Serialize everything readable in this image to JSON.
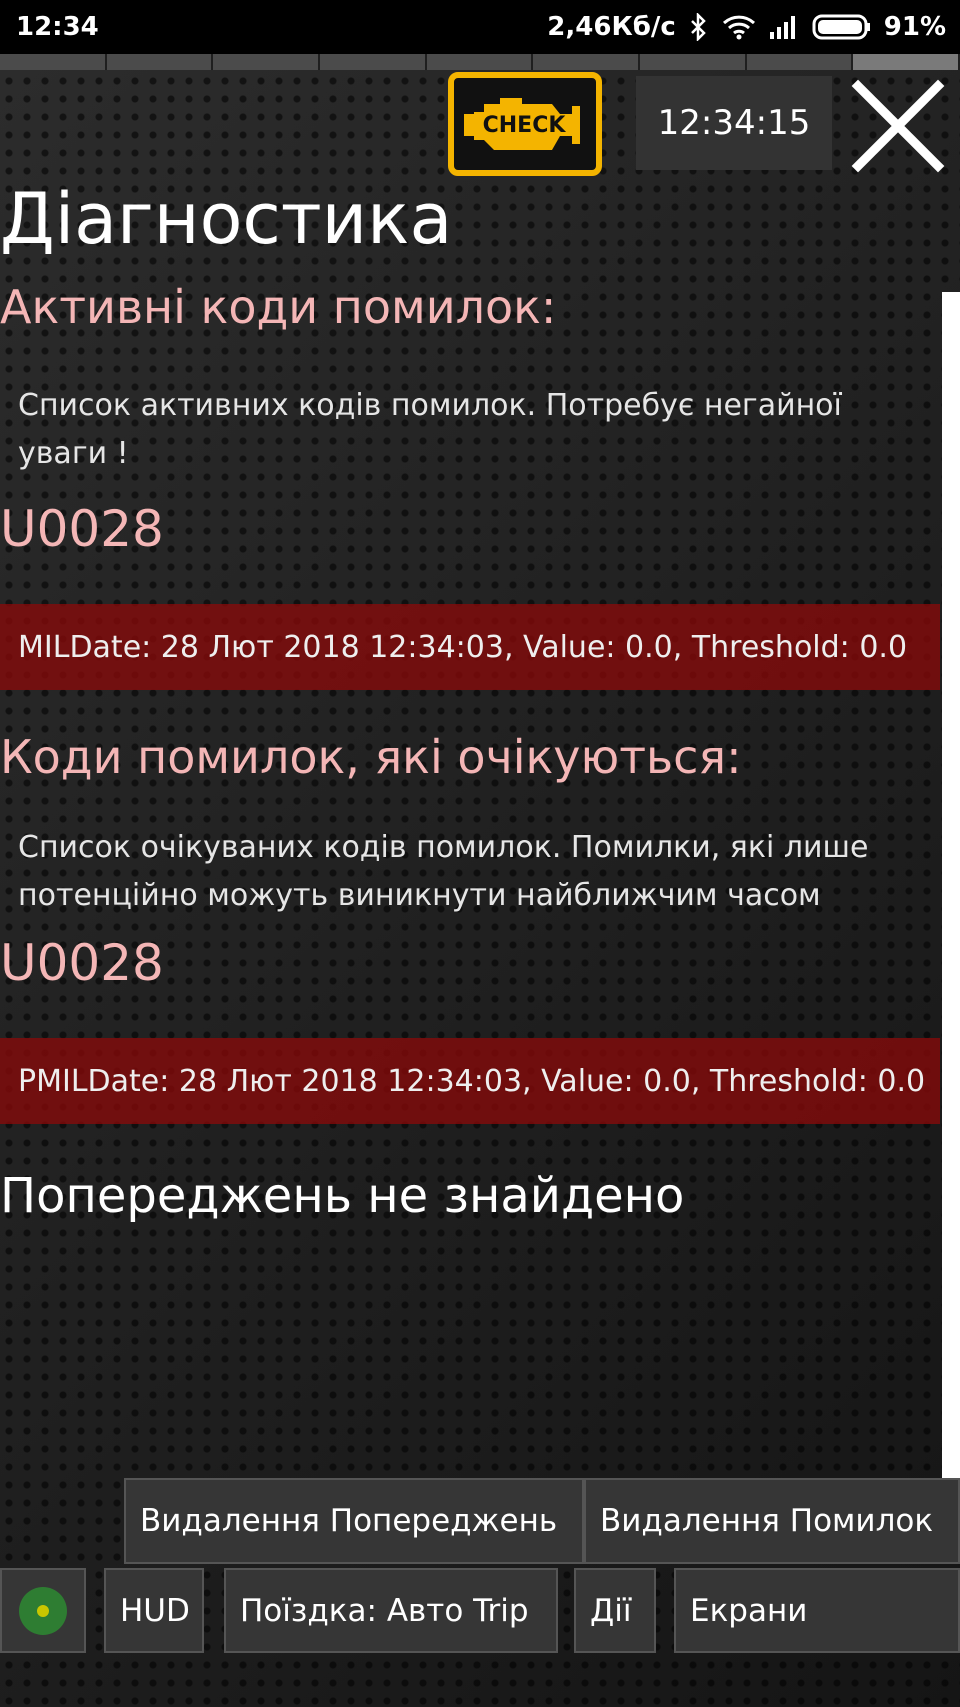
{
  "status": {
    "time": "12:34",
    "speed": "2,46Кб/с",
    "battery": "91%"
  },
  "header": {
    "check_label": "CHECK",
    "clock": "12:34:15"
  },
  "title": "Діагностика",
  "active": {
    "heading": "Активні коди помилок:",
    "description": "Список активних кодів помилок. Потребує негайної уваги !",
    "codes": [
      {
        "code": "U0028",
        "detail": "MILDate: 28 Лют 2018 12:34:03, Value: 0.0, Threshold: 0.0"
      }
    ]
  },
  "pending": {
    "heading": "Коди помилок, які очікуються:",
    "description": "Список очікуваних кодів помилок. Помилки, які лише потенційно можуть виникнути найближчим часом",
    "codes": [
      {
        "code": "U0028",
        "detail": "PMILDate: 28 Лют 2018 12:34:03, Value: 0.0, Threshold: 0.0"
      }
    ]
  },
  "no_warnings": "Попереджень не знайдено",
  "actions": {
    "delete_warnings": "Видалення Попереджень",
    "delete_errors": "Видалення Помилок"
  },
  "bottom_nav": {
    "hud": "HUD",
    "trip": "Поїздка: Авто Trip",
    "actions": "Дії",
    "screens": "Екрани"
  },
  "colors": {
    "accent_heading": "#f4b6b6",
    "check_yellow": "#f4b400",
    "error_row": "#8c0a0a",
    "status_dot": "#2e7d32"
  }
}
